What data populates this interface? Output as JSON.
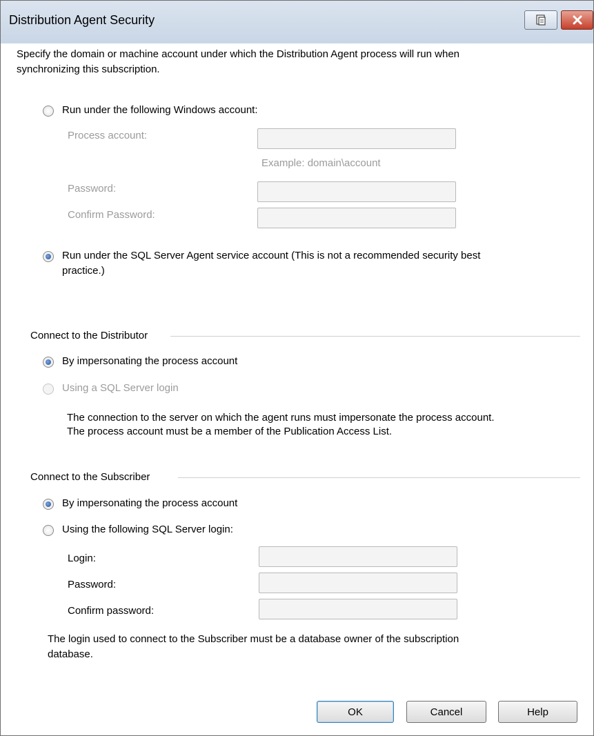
{
  "window": {
    "title": "Distribution Agent Security",
    "help_icon": "help-icon",
    "close_icon": "close-icon"
  },
  "intro": {
    "line1": "Specify the domain or machine account under which the Distribution Agent process will run when",
    "line2": "synchronizing this subscription."
  },
  "process_account": {
    "option_windows": "Run under the following Windows account:",
    "process_account_label": "Process account:",
    "example": "Example: domain\\account",
    "password_label": "Password:",
    "confirm_password_label": "Confirm Password:",
    "process_account_value": "",
    "password_value": "",
    "confirm_password_value": "",
    "option_agent_line1": "Run under the SQL Server Agent service account (This is not a recommended security best",
    "option_agent_line2": "practice.)",
    "selected": "agent"
  },
  "distributor": {
    "group_label": "Connect to the Distributor",
    "option_impersonate": "By impersonating the process account",
    "option_sql_login": "Using a SQL Server login",
    "note_line1": "The connection to the server on which the agent runs must impersonate the process account.",
    "note_line2": "The process account must be a member of the Publication Access List.",
    "selected": "impersonate"
  },
  "subscriber": {
    "group_label": "Connect to the Subscriber",
    "option_impersonate": "By impersonating the process account",
    "option_sql_login": "Using the following SQL Server login:",
    "login_label": "Login:",
    "password_label": "Password:",
    "confirm_password_label": "Confirm password:",
    "login_value": "",
    "password_value": "",
    "confirm_password_value": "",
    "note_line1": "The login used to connect to the Subscriber must be a database owner of the subscription",
    "note_line2": "database.",
    "selected": "impersonate"
  },
  "buttons": {
    "ok": "OK",
    "cancel": "Cancel",
    "help": "Help"
  }
}
